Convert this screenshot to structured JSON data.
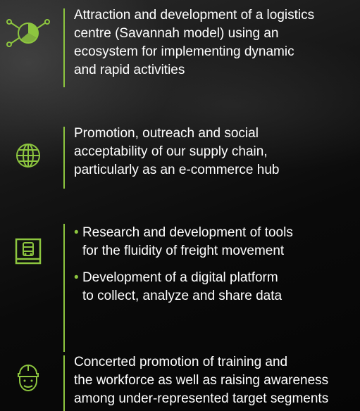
{
  "colors": {
    "accent": "#8dc63f",
    "text": "#ffffff",
    "background": "#0a0a0a"
  },
  "items": [
    {
      "icon": "pie-chart-network-icon",
      "lines": [
        "Attraction and development of a logistics",
        "centre (Savannah model) using an",
        "ecosystem for implementing dynamic",
        "and rapid activities"
      ]
    },
    {
      "icon": "globe-icon",
      "lines": [
        "Promotion, outreach and social",
        "acceptability of our supply chain,",
        "particularly as an e-commerce hub"
      ]
    },
    {
      "icon": "truck-screen-icon",
      "bullets": [
        {
          "marker": "•",
          "line1": "Research and development of tools",
          "line2": "for the fluidity of freight movement"
        },
        {
          "marker": "•",
          "line1": "Development of a digital platform",
          "line2": "to collect, analyze and share data"
        }
      ]
    },
    {
      "icon": "worker-helmet-icon",
      "lines": [
        "Concerted promotion of training and",
        "the workforce as well as raising awareness",
        "among under-represented target segments"
      ]
    }
  ]
}
